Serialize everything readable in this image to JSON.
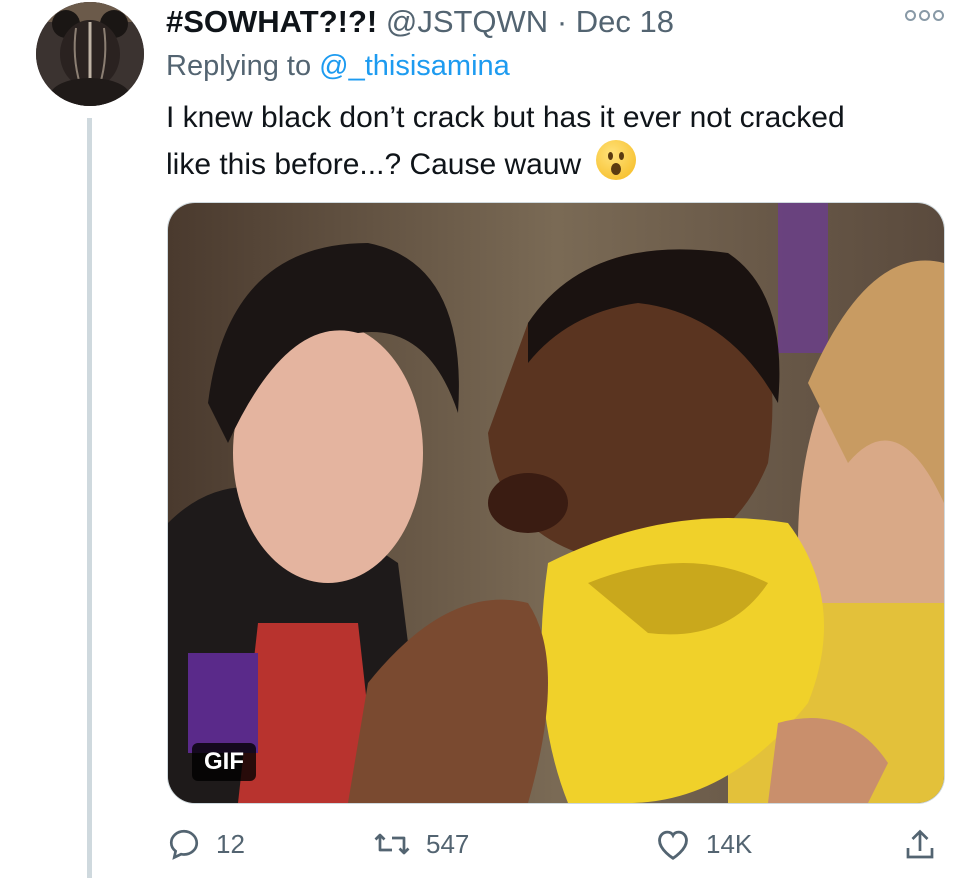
{
  "tweet": {
    "display_name": "#SOWHAT?!?!",
    "handle": "@JSTQWN",
    "separator": "·",
    "date": "Dec 18",
    "reply_prefix": "Replying to",
    "reply_handle": "@_thisisamina",
    "text": "I knew black don’t crack but has it ever not cracked like this before...? Cause wauw",
    "emoji": "hushed-face-emoji",
    "media": {
      "badge": "GIF"
    },
    "actions": {
      "replies": "12",
      "retweets": "547",
      "likes": "14K"
    }
  },
  "colors": {
    "link": "#1d9bf0",
    "muted": "#536471",
    "text": "#0f1419"
  }
}
